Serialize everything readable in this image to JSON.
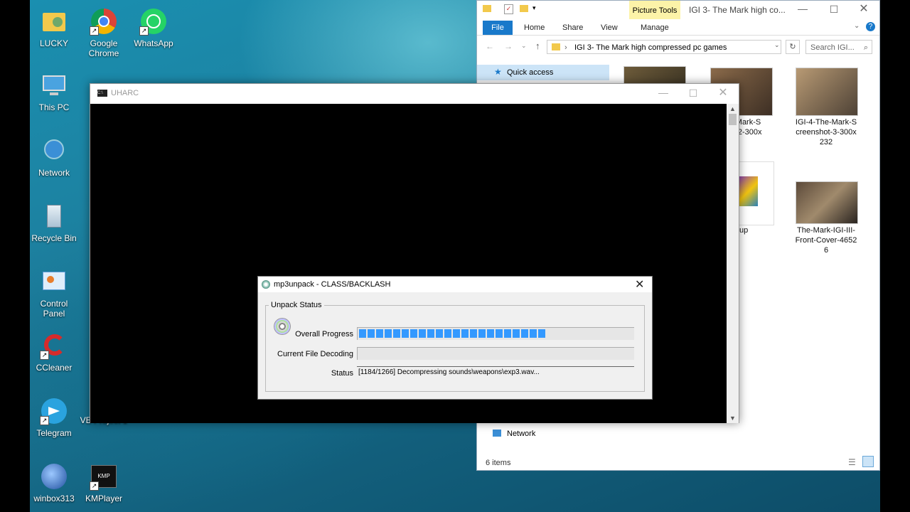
{
  "desktop": {
    "icons": [
      {
        "label": "LUCKY",
        "icon": "user-folder-icon"
      },
      {
        "label": "Google Chrome",
        "icon": "chrome-icon"
      },
      {
        "label": "WhatsApp",
        "icon": "whatsapp-icon"
      },
      {
        "label": "This PC",
        "icon": "computer-icon"
      },
      {
        "label": "Network",
        "icon": "network-icon"
      },
      {
        "label": "Recycle Bin",
        "icon": "recycle-bin-icon"
      },
      {
        "label": "Control Panel",
        "icon": "control-panel-icon"
      },
      {
        "label": "CCleaner",
        "icon": "ccleaner-icon"
      },
      {
        "label": "Telegram",
        "icon": "telegram-icon"
      },
      {
        "label": "VE Project 1",
        "icon": "project-icon"
      },
      {
        "label": "winbox313",
        "icon": "winbox-icon"
      },
      {
        "label": "KMPlayer",
        "icon": "kmplayer-icon"
      }
    ]
  },
  "explorer": {
    "title": "IGI 3- The Mark high co...",
    "context_tab": "Picture Tools",
    "tabs": [
      "File",
      "Home",
      "Share",
      "View",
      "Manage"
    ],
    "address": "IGI 3- The Mark high compressed pc games",
    "search_placeholder": "Search IGI...",
    "nav_quick_access": "Quick access",
    "nav_network": "Network",
    "status_items": "6 items",
    "files": [
      {
        "caption": "e-Mark-S\not-2-300x\n32"
      },
      {
        "caption": "IGI-4-The-Mark-S\ncreenshot-3-300x\n232"
      },
      {
        "caption": "tup"
      },
      {
        "caption": "The-Mark-IGI-III-\nFront-Cover-4652\n6"
      }
    ]
  },
  "uharc": {
    "title": "UHARC"
  },
  "dialog": {
    "title": "mp3unpack - CLASS/BACKLASH",
    "group_label": "Unpack Status",
    "overall_label": "Overall Progress",
    "overall_progress": 0.7,
    "decoding_label": "Current File Decoding",
    "decoding_progress": 0,
    "status_label": "Status",
    "status_text": "[1184/1266] Decompressing sounds\\weapons\\exp3.wav..."
  },
  "colors": {
    "progress": "#3399ff",
    "file_tab": "#1979ca",
    "picture_tools": "#fcf3a8"
  }
}
